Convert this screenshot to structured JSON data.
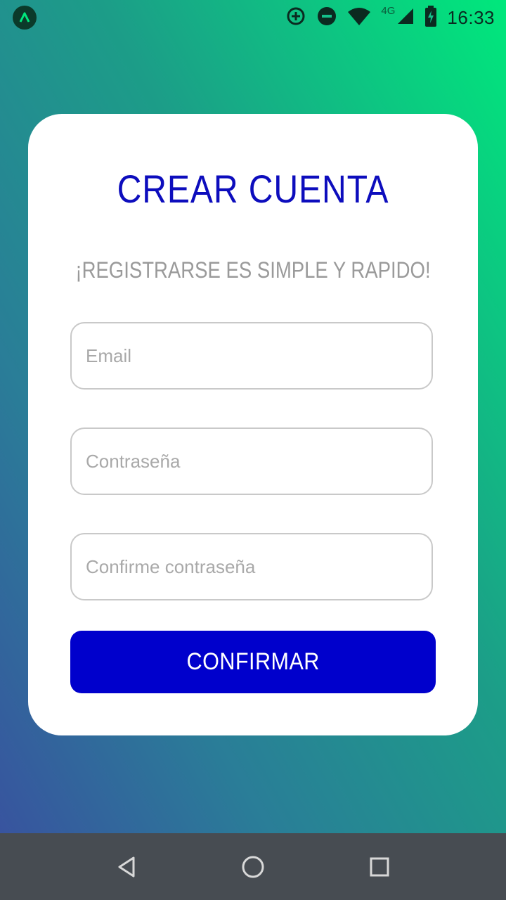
{
  "status_bar": {
    "time": "16:33",
    "network": "4G",
    "icons": [
      "app-logo-icon",
      "data-saver-icon",
      "do-not-disturb-icon",
      "wifi-icon",
      "signal-icon",
      "battery-charging-icon"
    ]
  },
  "form": {
    "title": "CREAR CUENTA",
    "subtitle": "¡REGISTRARSE ES SIMPLE Y RAPIDO!",
    "email_placeholder": "Email",
    "password_placeholder": "Contraseña",
    "confirm_placeholder": "Confirme contraseña",
    "confirm_label": "CONFIRMAR"
  },
  "nav_bar": {
    "buttons": [
      "back-icon",
      "home-icon",
      "recents-icon"
    ]
  },
  "colors": {
    "title": "#0d0dbd",
    "button": "#0000cc",
    "gradient_top": "#00e87c",
    "gradient_bottom": "#3a4ea0"
  }
}
